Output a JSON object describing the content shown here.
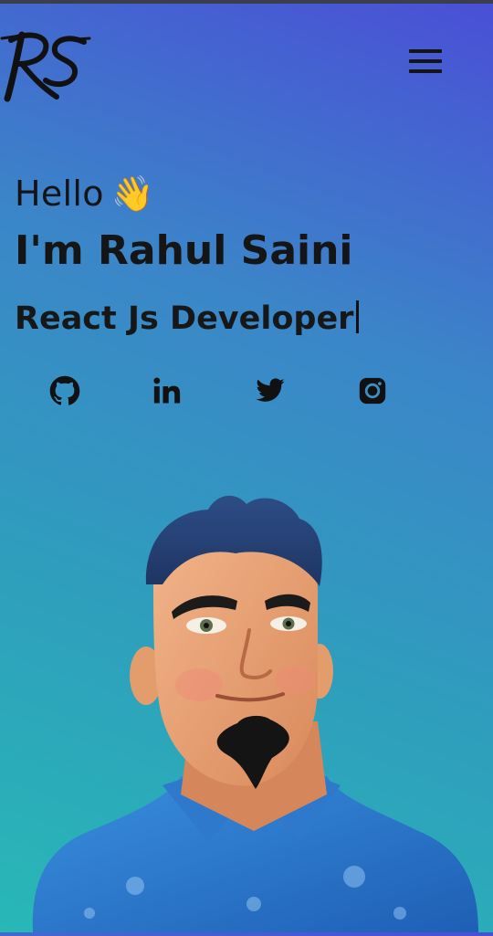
{
  "header": {
    "logo_text": "RS",
    "menu_icon": "hamburger-menu-icon"
  },
  "hero": {
    "greeting": "Hello",
    "wave_emoji": "👋",
    "name_line": "I'm Rahul Saini",
    "role": "React Js Developer"
  },
  "socials": [
    {
      "icon": "github-icon"
    },
    {
      "icon": "linkedin-icon"
    },
    {
      "icon": "twitter-icon"
    },
    {
      "icon": "instagram-icon"
    }
  ],
  "colors": {
    "gradient_top": "#4a4fd6",
    "gradient_mid": "#3b86c8",
    "gradient_bottom": "#28b8b6",
    "text": "#151515"
  }
}
